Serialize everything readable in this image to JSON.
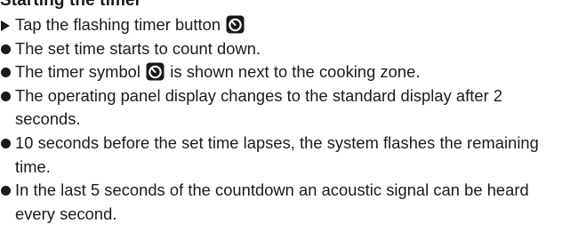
{
  "section": {
    "heading": "Starting the timer",
    "items": [
      {
        "marker": "arrow",
        "text_before": "Tap the flashing timer button",
        "icon": "timer-icon"
      },
      {
        "marker": "bullet",
        "text": "The set time starts to count down."
      },
      {
        "marker": "bullet",
        "text_before": "The timer symbol",
        "icon": "timer-icon",
        "text_after": "is shown next to the cooking zone."
      },
      {
        "marker": "bullet",
        "text": "The operating panel display changes to the standard display after 2 seconds."
      },
      {
        "marker": "bullet",
        "text": "10 seconds before the set time lapses, the system flashes the remaining time."
      },
      {
        "marker": "bullet",
        "text": "In the last 5 seconds of the countdown an acoustic signal can be heard every second."
      }
    ]
  },
  "colors": {
    "text": "#1a1a1a",
    "icon_fill": "#1a1a1a",
    "icon_glyph": "#ffffff"
  }
}
